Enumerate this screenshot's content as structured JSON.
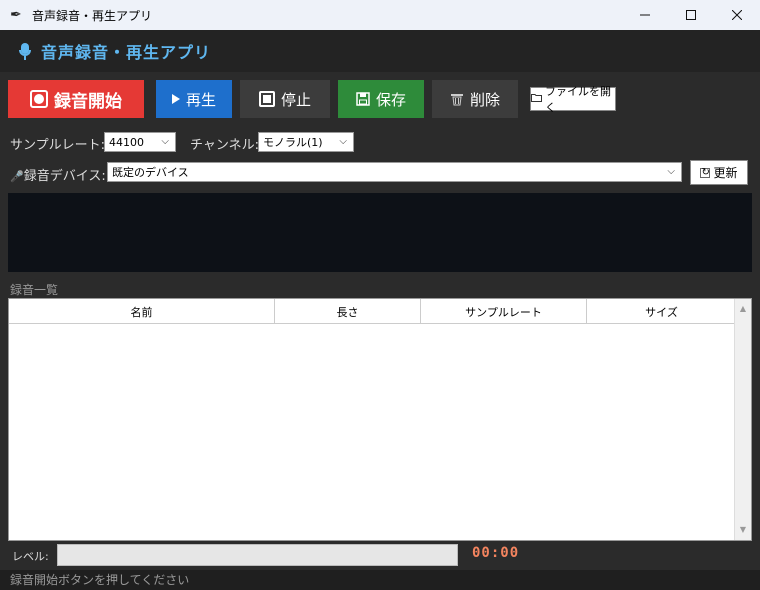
{
  "window": {
    "title": "音声録音・再生アプリ",
    "icon": "feather-pen-icon",
    "controls": [
      "minimize",
      "maximize",
      "close"
    ]
  },
  "header": {
    "icon": "microphone-icon",
    "title": "音声録音・再生アプリ",
    "color": "#5fb7f0"
  },
  "toolbar": {
    "record_label": "録音開始",
    "play_label": "再生",
    "stop_label": "停止",
    "save_label": "保存",
    "delete_label": "削除",
    "open_label": "ファイルを開く",
    "colors": {
      "record": "#e53935",
      "play": "#1e6fcc",
      "save": "#2e8b3a",
      "neutral": "#3c3c3c"
    }
  },
  "settings": {
    "sample_rate_label": "サンプルレート:",
    "sample_rate_value": "44100",
    "channel_label": "チャンネル:",
    "channel_value": "モノラル(1)",
    "device_label": "録音デバイス:",
    "device_value": "既定のデバイス",
    "refresh_label": "更新"
  },
  "recordings": {
    "title": "録音一覧",
    "columns": [
      "名前",
      "長さ",
      "サンプルレート",
      "サイズ"
    ],
    "rows": []
  },
  "level": {
    "label": "レベル:",
    "value": 0,
    "timer": "00:00",
    "timer_color": "#f4845f"
  },
  "status": {
    "text": "録音開始ボタンを押してください"
  }
}
